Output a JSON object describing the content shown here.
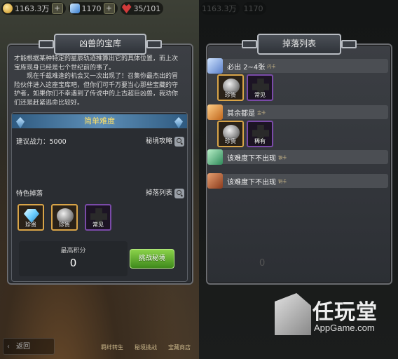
{
  "top_bar": {
    "gold": "1163.3万",
    "gems": "1170",
    "stamina": "35/101",
    "plus": "+"
  },
  "left": {
    "panel_title": "凶兽的宝库",
    "intro_p1": "才能根据某种特定的星辰轨迹推算出它的具体位置，而上次宝库现身已经是七个世纪前的事了。",
    "intro_p2": "现在千载难逢的机会又一次出现了！召集你最杰出的冒险伙伴进入这座宝库吧，但你们可千万要当心那些宝藏的守护者，如果你们不幸遇到了传说中的上古超巨凶兽，我劝你们还是赶紧逃命比较好。",
    "difficulty": "简单难度",
    "power_label": "建议战力：5000",
    "guide_label": "秘境攻略",
    "drops_label": "特色掉落",
    "drop_list_label": "掉落列表",
    "items": [
      {
        "cap": "珍贵",
        "icon": "diamond-icon",
        "frame": "gold"
      },
      {
        "cap": "珍贵",
        "icon": "stone-icon",
        "frame": "gold"
      },
      {
        "cap": "常见",
        "icon": "puzzle-icon",
        "frame": "purple"
      }
    ],
    "score_label": "最高积分",
    "score_value": "0",
    "challenge_btn": "挑战秘境",
    "back_btn": "返回",
    "bottom_nav": [
      "羁绊转生",
      "秘境挑战",
      "宝藏商店"
    ]
  },
  "right": {
    "panel_title": "掉落列表",
    "groups": [
      {
        "title": "必出 2~4张",
        "tag": "闪卡",
        "items": [
          {
            "cap": "珍贵",
            "icon": "stone-icon",
            "frame": "gold"
          },
          {
            "cap": "常见",
            "icon": "puzzle-icon",
            "frame": "purple"
          }
        ]
      },
      {
        "title": "其余都是",
        "tag": "金卡",
        "items": [
          {
            "cap": "珍贵",
            "icon": "stone-icon",
            "frame": "gold"
          },
          {
            "cap": "稀有",
            "icon": "puzzle-icon",
            "frame": "purple"
          }
        ]
      },
      {
        "title": "该难度下不出现",
        "tag": "银卡",
        "items": []
      },
      {
        "title": "该难度下不出现",
        "tag": "铜卡",
        "items": []
      }
    ],
    "bg_score": "0",
    "watermark_cn": "任玩堂",
    "watermark_en": "AppGame.com"
  },
  "colors": {
    "gold_frame": "#d8a448",
    "purple_frame": "#7a4aa8",
    "difficulty_text": "#ffe066",
    "challenge_btn": "#5fae2c"
  }
}
